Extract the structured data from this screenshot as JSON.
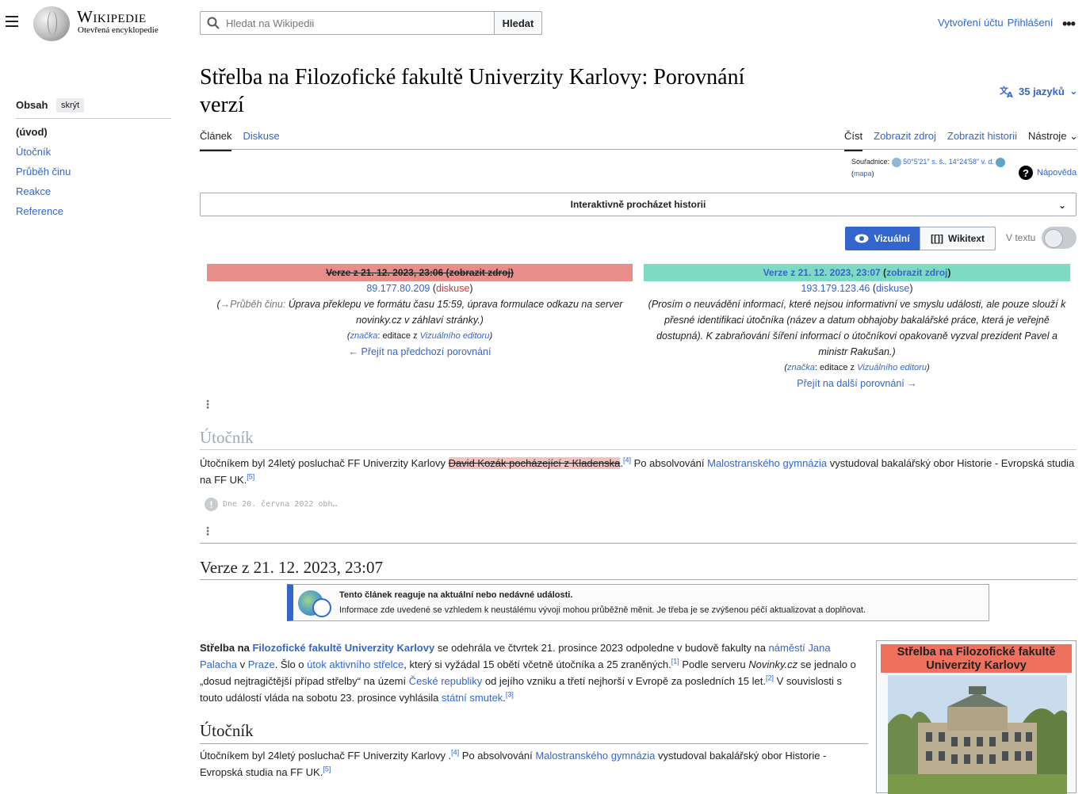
{
  "header": {
    "wordmark": "Wikipedie",
    "tagline": "Otevřená encyklopedie",
    "search_placeholder": "Hledat na Wikipedii",
    "search_button": "Hledat",
    "create_account": "Vytvoření účtu",
    "login": "Přihlášení"
  },
  "toc": {
    "title": "Obsah",
    "hide": "skrýt",
    "items": [
      "(úvod)",
      "Útočník",
      "Průběh činu",
      "Reakce",
      "Reference"
    ]
  },
  "page": {
    "title": "Střelba na Filozofické fakultě Univerzity Karlovy: Porovnání verzí",
    "languages": "35 jazyků"
  },
  "tabs": {
    "left": [
      "Článek",
      "Diskuse"
    ],
    "right": [
      "Číst",
      "Zobrazit zdroj",
      "Zobrazit historii",
      "Nástroje"
    ]
  },
  "coords": {
    "label": "Souřadnice:",
    "value": "50°5′21″ s. š., 14°24′58″ v. d.",
    "map": "mapa"
  },
  "help": "Nápověda",
  "history_bar": "Interaktivně procházet historii",
  "view_toggle": {
    "visual": "Vizuální",
    "wikitext": "Wikitext",
    "inline": "V textu"
  },
  "diff": {
    "old": {
      "version": "Verze z 21. 12. 2023, 23:06",
      "source": "zobrazit zdroj",
      "user": "89.177.80.209",
      "talk": "diskuse",
      "section": "→Průběh činu:",
      "summary": "Úprava překlepu ve formátu času 15:59, úprava formulace odkazu na server novinky.cz v záhlaví stránky.",
      "tag_prefix": "značka",
      "tag_mid": ": editace z ",
      "tag_editor": "Vizuálního editoru",
      "nav": "← Přejít na předchozí porovnání"
    },
    "new": {
      "version": "Verze z 21. 12. 2023, 23:07",
      "source": "zobrazit zdroj",
      "user": "193.179.123.46",
      "talk": "diskuse",
      "summary": "Prosím o neuvádění informací, které nejsou informativní ve smyslu události, ale pouze slouží k přesné identifikaci útočníka (název a datum obhajoby bakalářské práce, která je veřejně dostupná). K zabraňování šíření informací o útočníkovi opakovaně vyzval prezident Pavel a ministr Rakušan.",
      "tag_prefix": "značka",
      "tag_mid": ": editace z ",
      "tag_editor": "Vizuálního editoru",
      "nav": "Přejít na další porovnání →"
    },
    "section_heading": "Útočník",
    "para_start": "Útočníkem byl 24letý posluchač FF Univerzity Karlovy ",
    "deleted_text": "David Kozák pocházející z Kladenska",
    "ref4": "[4]",
    "para_mid": " Po absolvování ",
    "link_gym": "Malostranského gymnázia",
    "para_end": " vystudoval bakalářský obor Historie - Evropská studia na FF UK.",
    "ref5": "[5]",
    "collapsed_note": "Dne 20. června 2022 obh…"
  },
  "version_heading": "Verze z 21. 12. 2023, 23:07",
  "ambox": {
    "title": "Tento článek reaguje na aktuální nebo nedávné události.",
    "text": "Informace zde uvedené se vzhledem k neustálému vývoji mohou průběžně měnit. Je třeba je se zvýšenou péčí aktualizovat a doplňovat."
  },
  "lead": {
    "b1": "Střelba na ",
    "l1": "Filozofické fakultě Univerzity Karlovy",
    "t1": " se odehrála ve čtvrtek 21. prosince 2023 odpoledne v budově fakulty na ",
    "l2": "náměstí Jana Palacha",
    "t2": " v ",
    "l3": "Praze",
    "t3": ". Šlo o ",
    "l4": "útok aktivního střelce",
    "t4": ", který si vyžádal 15 obětí včetně útočníka a 25 zraněných.",
    "r1": "[1]",
    "t5": " Podle serveru ",
    "i1": "Novinky.cz",
    "t6": " se jednalo o „dosud nejtragičtější případ střelby“ na území ",
    "l5": "České republiky",
    "t7": " od jejího vzniku a třetí nejhorší v Evropě za posledních 15 let.",
    "r2": "[2]",
    "t8": " V souvislosti s touto událostí vláda na sobotu 23. prosince vyhlásila ",
    "l6": "státní smutek",
    "t9": ".",
    "r3": "[3]"
  },
  "section_new": {
    "heading": "Útočník",
    "p1": "Útočníkem byl 24letý posluchač FF Univerzity Karlovy .",
    "ref4": "[4]",
    "p2": " Po absolvování ",
    "link": "Malostranského gymnázia",
    "p3": " vystudoval bakalářský obor Historie - Evropská studia na FF UK.",
    "ref5": "[5]"
  },
  "infobox": {
    "title": "Střelba na Filozofické fakultě Univerzity Karlovy"
  }
}
